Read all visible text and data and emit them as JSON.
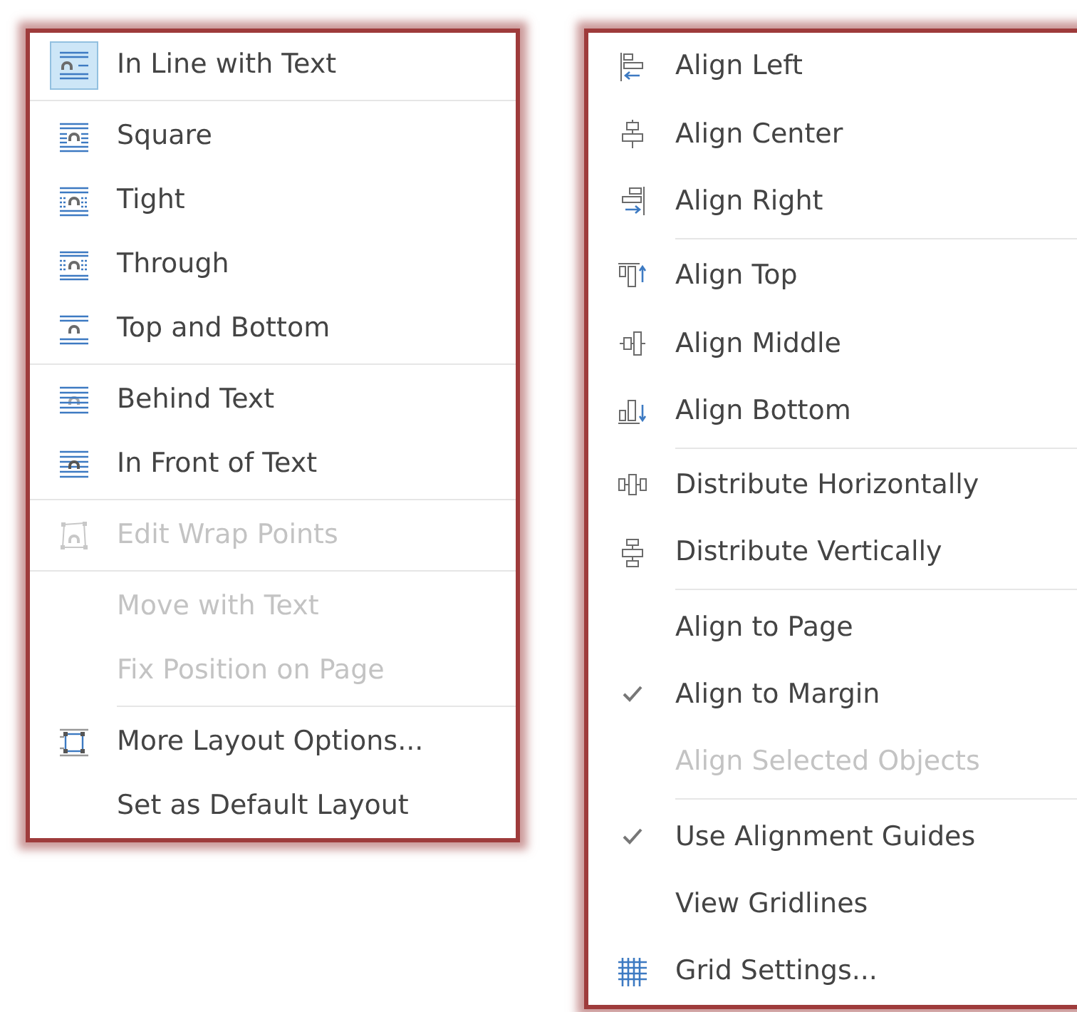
{
  "menus": [
    {
      "items": [
        {
          "kind": "item",
          "label": "In Line with Text",
          "checked": true,
          "disabled": false
        },
        {
          "kind": "separator"
        },
        {
          "kind": "item",
          "label": "Square",
          "checked": false,
          "disabled": false
        },
        {
          "kind": "item",
          "label": "Tight",
          "checked": false,
          "disabled": false
        },
        {
          "kind": "item",
          "label": "Through",
          "checked": false,
          "disabled": false
        },
        {
          "kind": "item",
          "label": "Top and Bottom",
          "checked": false,
          "disabled": false
        },
        {
          "kind": "separator"
        },
        {
          "kind": "item",
          "label": "Behind Text",
          "checked": false,
          "disabled": false
        },
        {
          "kind": "item",
          "label": "In Front of Text",
          "checked": false,
          "disabled": false
        },
        {
          "kind": "separator"
        },
        {
          "kind": "item",
          "label": "Edit Wrap Points",
          "checked": false,
          "disabled": true
        },
        {
          "kind": "separator"
        },
        {
          "kind": "item",
          "label": "Move with Text",
          "checked": false,
          "disabled": true
        },
        {
          "kind": "item",
          "label": "Fix Position on Page",
          "checked": false,
          "disabled": true
        },
        {
          "kind": "short-separator"
        },
        {
          "kind": "item",
          "label": "More Layout Options...",
          "checked": false,
          "disabled": false
        },
        {
          "kind": "item",
          "label": "Set as Default Layout",
          "checked": false,
          "disabled": false
        }
      ]
    },
    {
      "items": [
        {
          "kind": "item",
          "label": "Align Left",
          "checked": false,
          "disabled": false
        },
        {
          "kind": "item",
          "label": "Align Center",
          "checked": false,
          "disabled": false
        },
        {
          "kind": "item",
          "label": "Align Right",
          "checked": false,
          "disabled": false
        },
        {
          "kind": "short-separator"
        },
        {
          "kind": "item",
          "label": "Align Top",
          "checked": false,
          "disabled": false
        },
        {
          "kind": "item",
          "label": "Align Middle",
          "checked": false,
          "disabled": false
        },
        {
          "kind": "item",
          "label": "Align Bottom",
          "checked": false,
          "disabled": false
        },
        {
          "kind": "short-separator"
        },
        {
          "kind": "item",
          "label": "Distribute Horizontally",
          "checked": false,
          "disabled": false
        },
        {
          "kind": "item",
          "label": "Distribute Vertically",
          "checked": false,
          "disabled": false
        },
        {
          "kind": "short-separator"
        },
        {
          "kind": "item",
          "label": "Align to Page",
          "checked": false,
          "disabled": false
        },
        {
          "kind": "item",
          "label": "Align to Margin",
          "checked": true,
          "disabled": false
        },
        {
          "kind": "item",
          "label": "Align Selected Objects",
          "checked": false,
          "disabled": true
        },
        {
          "kind": "short-separator"
        },
        {
          "kind": "item",
          "label": "Use Alignment Guides",
          "checked": true,
          "disabled": false
        },
        {
          "kind": "item",
          "label": "View Gridlines",
          "checked": false,
          "disabled": false
        },
        {
          "kind": "item",
          "label": "Grid Settings...",
          "checked": false,
          "disabled": false
        }
      ]
    }
  ]
}
